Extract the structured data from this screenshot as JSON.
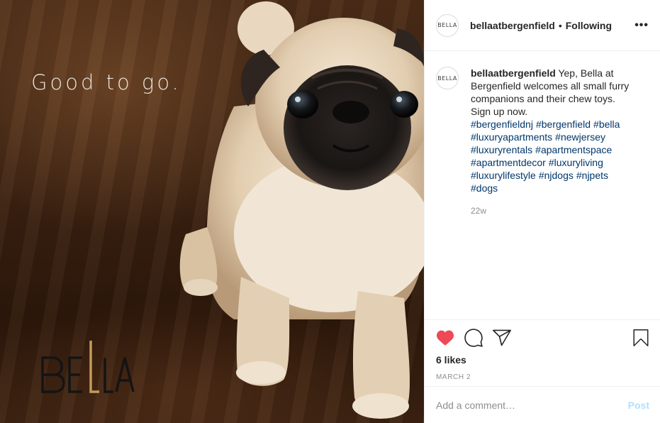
{
  "photo": {
    "overlay_text": "Good to go.",
    "logo_text": "BELLA"
  },
  "header": {
    "avatar_text": "BELLA",
    "username": "bellaatbergenfield",
    "separator": "•",
    "follow_status": "Following",
    "more_icon": "ellipsis-icon",
    "more_label": "•••"
  },
  "caption": {
    "avatar_text": "BELLA",
    "username": "bellaatbergenfield",
    "text_line1": " Yep, Bella at Bergenfield welcomes all small furry companions and their chew toys.",
    "text_line2": "Sign up now.",
    "hashtags": [
      "#bergenfieldnj",
      "#bergenfield",
      "#bella",
      "#luxuryapartments",
      "#newjersey",
      "#luxuryrentals",
      "#apartmentspace",
      "#apartmentdecor",
      "#luxuryliving",
      "#luxurylifestyle",
      "#njdogs",
      "#njpets",
      "#dogs"
    ],
    "time_ago": "22w"
  },
  "actions": {
    "like_icon": "heart-filled-icon",
    "comment_icon": "comment-icon",
    "share_icon": "share-icon",
    "save_icon": "bookmark-icon",
    "likes": "6 likes",
    "date": "MARCH 2"
  },
  "comment_box": {
    "placeholder": "Add a comment…",
    "post_label": "Post"
  },
  "colors": {
    "like_red": "#ed4956",
    "hashtag_blue": "#00376b",
    "post_disabled": "#b2dffc",
    "muted_gray": "#8e8e8e"
  }
}
